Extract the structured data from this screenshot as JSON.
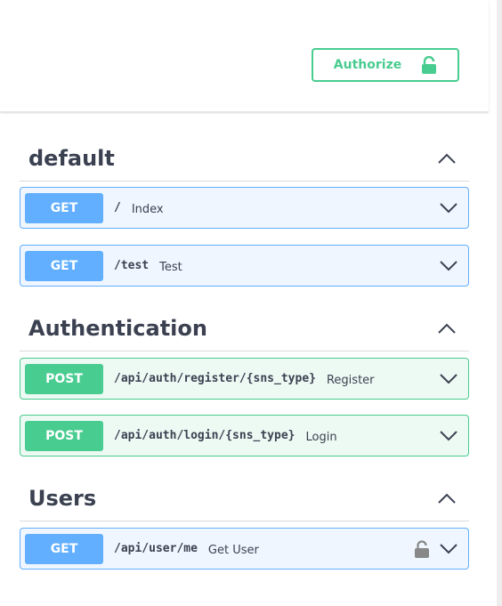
{
  "header": {
    "authorize_label": "Authorize",
    "accent_color": "#49cc90"
  },
  "colors": {
    "get": "#61affe",
    "post": "#49cc90",
    "text": "#3b4151"
  },
  "tags": [
    {
      "name": "default",
      "operations": [
        {
          "method": "GET",
          "path": "/",
          "summary": "Index",
          "locked": false
        },
        {
          "method": "GET",
          "path": "/test",
          "summary": "Test",
          "locked": false
        }
      ]
    },
    {
      "name": "Authentication",
      "operations": [
        {
          "method": "POST",
          "path": "/api/auth/register/{sns_type}",
          "summary": "Register",
          "locked": false
        },
        {
          "method": "POST",
          "path": "/api/auth/login/{sns_type}",
          "summary": "Login",
          "locked": false
        }
      ]
    },
    {
      "name": "Users",
      "operations": [
        {
          "method": "GET",
          "path": "/api/user/me",
          "summary": "Get User",
          "locked": true,
          "lock_icon": "lock-icon"
        }
      ]
    }
  ]
}
